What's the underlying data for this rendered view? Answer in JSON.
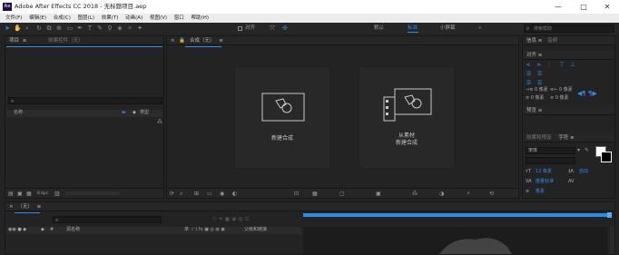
{
  "window": {
    "app_logo": "Ae",
    "title": "Adobe After Effects CC 2018 - 无标题项目.aep",
    "controls": {
      "minimize": "—",
      "maximize": "□",
      "close": "✕"
    }
  },
  "menu": [
    "文件(F)",
    "编辑(E)",
    "合成(C)",
    "图层(L)",
    "效果(T)",
    "动画(A)",
    "视图(V)",
    "窗口",
    "帮助(H)"
  ],
  "toolbar": {
    "align_label": "对齐",
    "workspaces": [
      "默认",
      "标准",
      "小屏幕"
    ],
    "active_workspace": "标准",
    "search_help": "搜索帮助"
  },
  "project_panel": {
    "tab_project": "项目",
    "tab_effect_controls": "效果控件（无）",
    "column_name": "名称",
    "column_type": "类型",
    "bpc": "8 bpc"
  },
  "composition_panel": {
    "tab": "合成（无）",
    "new_comp_label": "新建合成",
    "from_footage_line1": "从素材",
    "from_footage_line2": "新建合成"
  },
  "right_panels": {
    "info_tab": "信息",
    "audio_tab": "音频",
    "align_tab": "对齐",
    "preview_tab": "预览",
    "effects_tab": "效果和预设",
    "character_tab": "字符",
    "font_name": "宋体",
    "font_size": "12 像素",
    "tracking": "度量标准",
    "baseline": "自动",
    "px_auto": "像素"
  },
  "timeline": {
    "tab": "（无）",
    "column_source": "源名称",
    "column_parent": "父级和链接",
    "column_modes": "单 ☆ \\ fx ▣ ◎ ◍ ◉"
  },
  "colors": {
    "accent_blue": "#2d8ceb",
    "panel_bg": "#232323",
    "title_bg": "#ffffff"
  }
}
